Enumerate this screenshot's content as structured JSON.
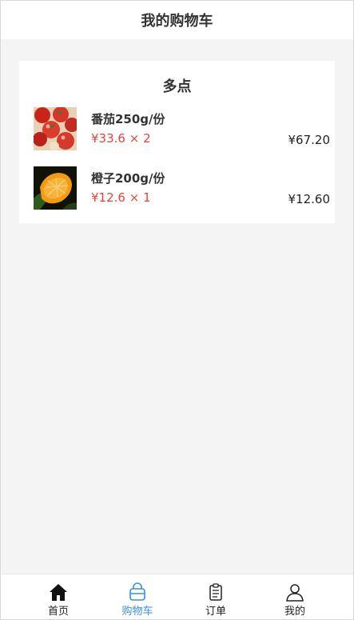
{
  "header": {
    "title": "我的购物车"
  },
  "shop": {
    "name": "多点",
    "items": [
      {
        "name": "番茄250g/份",
        "unit_price": "¥33.6",
        "times": "×",
        "quantity": "2",
        "subtotal": "¥67.20",
        "image": "tomato-photo"
      },
      {
        "name": "橙子200g/份",
        "unit_price": "¥12.6",
        "times": "×",
        "quantity": "1",
        "subtotal": "¥12.60",
        "image": "orange-photo"
      }
    ]
  },
  "tabbar": {
    "tabs": [
      {
        "label": "首页",
        "icon": "home-icon"
      },
      {
        "label": "购物车",
        "icon": "shopping-bag-icon",
        "active": true
      },
      {
        "label": "订单",
        "icon": "clipboard-icon"
      },
      {
        "label": "我的",
        "icon": "user-icon"
      }
    ]
  },
  "colors": {
    "price": "#e0463a",
    "active_tab": "#3a8ee6",
    "background": "#f4f4f4"
  }
}
